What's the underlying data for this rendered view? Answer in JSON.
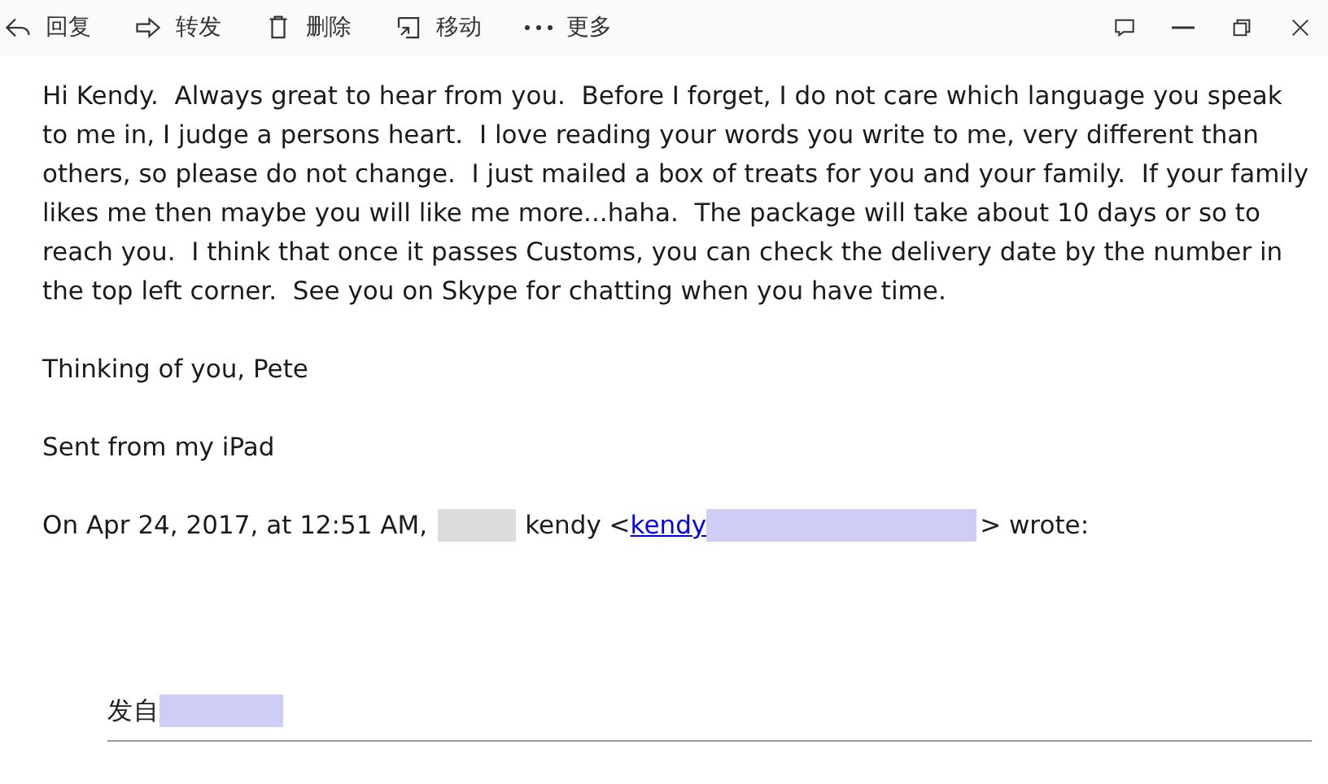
{
  "toolbar": {
    "actions": [
      {
        "kind": "reply",
        "label": "回复"
      },
      {
        "kind": "forward",
        "label": "转发"
      },
      {
        "kind": "delete",
        "label": "删除"
      },
      {
        "kind": "move",
        "label": "移动"
      },
      {
        "kind": "more",
        "label": "更多"
      }
    ],
    "window_controls": [
      {
        "kind": "comment"
      },
      {
        "kind": "minimize"
      },
      {
        "kind": "restore"
      },
      {
        "kind": "close"
      }
    ]
  },
  "body": {
    "paragraphs": [
      "Hi Kendy.  Always great to hear from you.  Before I forget, I do not care which language you speak to me in, I judge a persons heart.  I love reading your words you write to me, very different than others, so please do not change.  I just mailed a box of treats for you and your family.  If your family likes me then maybe you will like me more...haha.  The package will take about 10 days or so to reach you.  I think that once it passes Customs, you can check the delivery date by the number in the top left corner.  See you on Skype for chatting when you have time.",
      "Thinking of you, Pete",
      "Sent from my iPad"
    ],
    "quote_header": {
      "prefix": "On Apr 24, 2017, at 12:51 AM,",
      "name": "kendy <",
      "link": "kendy",
      "suffix": "> wrote:"
    },
    "quoted": {
      "sent_from": "发自"
    }
  }
}
